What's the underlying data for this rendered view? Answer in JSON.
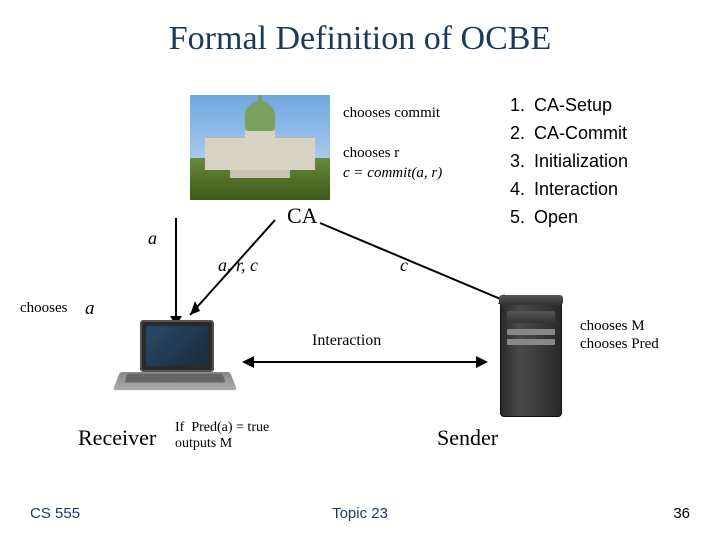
{
  "title": "Formal Definition of OCBE",
  "ca": {
    "label": "CA",
    "chooses_commit": "chooses commit",
    "chooses_r": "chooses r",
    "commit_formula": "c = commit(a, r)"
  },
  "receiver": {
    "chooses_label": "chooses",
    "a_var": "a",
    "down_label_a": "a",
    "down_label_arc": "a, r, c",
    "role": "Receiver",
    "if_text": "If",
    "pred_formula": "Pred(a) = true",
    "outputs": "outputs M"
  },
  "sender": {
    "down_label_c": "c",
    "role": "Sender",
    "chooses_m": "chooses M",
    "chooses_pred": "chooses Pred"
  },
  "interaction_label": "Interaction",
  "steps": [
    {
      "n": "1.",
      "t": "CA-Setup"
    },
    {
      "n": "2.",
      "t": "CA-Commit"
    },
    {
      "n": "3.",
      "t": "Initialization"
    },
    {
      "n": "4.",
      "t": "Interaction"
    },
    {
      "n": "5.",
      "t": "Open"
    }
  ],
  "footer": {
    "left": "CS 555",
    "center": "Topic 23",
    "right": "36"
  }
}
